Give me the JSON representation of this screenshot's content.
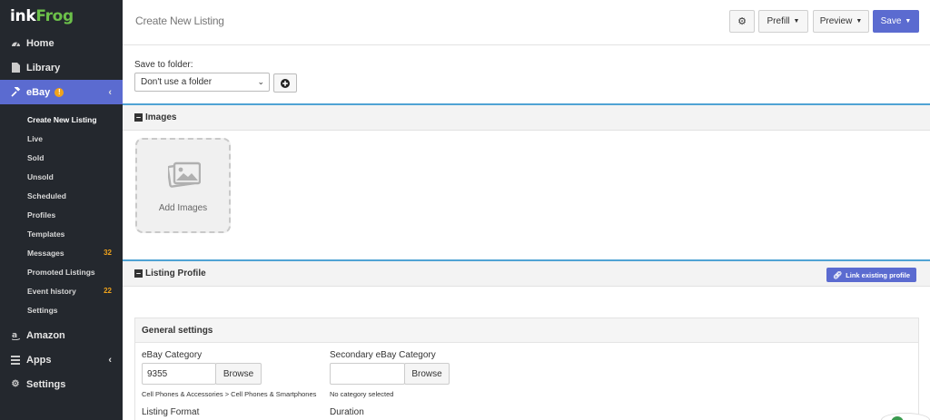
{
  "sidebar": {
    "logo_ink": "ink",
    "logo_frog": "Frog",
    "items": [
      {
        "label": "Home"
      },
      {
        "label": "Library"
      },
      {
        "label": "eBay",
        "badge": "!"
      },
      {
        "label": "Amazon"
      },
      {
        "label": "Apps"
      },
      {
        "label": "Settings"
      }
    ],
    "ebay_sub": [
      {
        "label": "Create New Listing"
      },
      {
        "label": "Live"
      },
      {
        "label": "Sold"
      },
      {
        "label": "Unsold"
      },
      {
        "label": "Scheduled"
      },
      {
        "label": "Profiles"
      },
      {
        "label": "Templates"
      },
      {
        "label": "Messages",
        "count": "32"
      },
      {
        "label": "Promoted Listings"
      },
      {
        "label": "Event history",
        "count": "22"
      },
      {
        "label": "Settings"
      }
    ]
  },
  "header": {
    "title": "Create New Listing",
    "gear_icon": "gear-icon",
    "prefill_label": "Prefill",
    "preview_label": "Preview",
    "save_label": "Save"
  },
  "folder": {
    "label": "Save to folder:",
    "selected": "Don't use a folder"
  },
  "images_section": {
    "title": "Images",
    "add_label": "Add Images"
  },
  "profile_section": {
    "title": "Listing Profile",
    "link_label": "Link existing profile"
  },
  "general": {
    "title": "General settings",
    "category_label": "eBay Category",
    "category_value": "9355",
    "browse_label": "Browse",
    "category_path": "Cell Phones & Accessories > Cell Phones & Smartphones",
    "secondary_label": "Secondary eBay Category",
    "secondary_value": "",
    "secondary_hint": "No category selected",
    "format_label": "Listing Format",
    "duration_label": "Duration"
  },
  "colors": {
    "accent": "#5b6bd0",
    "sidebar_bg": "#24282e",
    "logo_green": "#6cc04a",
    "badge_orange": "#f0a31b",
    "section_border": "#4fa3d4"
  }
}
